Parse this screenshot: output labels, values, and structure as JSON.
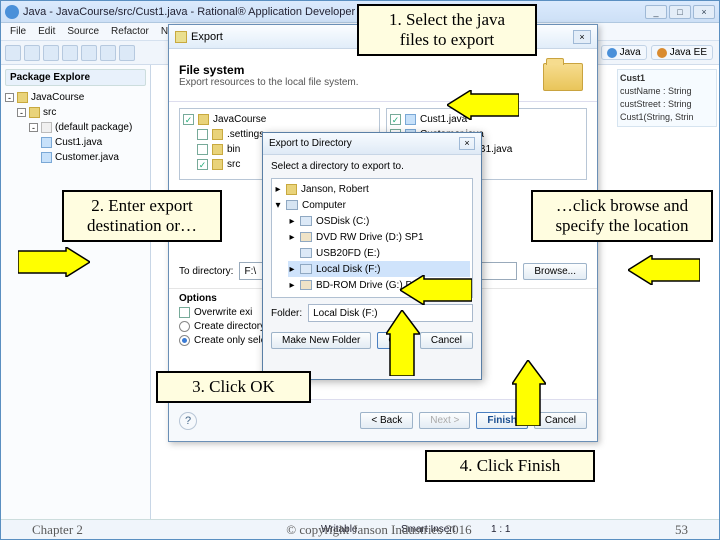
{
  "window": {
    "title": "Java - JavaCourse/src/Cust1.java - Rational® Application Developer for WebSphere® S…"
  },
  "win_btns": {
    "min": "_",
    "max": "□",
    "close": "×"
  },
  "menubar": [
    "File",
    "Edit",
    "Source",
    "Refactor",
    "Navig"
  ],
  "perspectives": {
    "java": "Java",
    "jee": "Java EE"
  },
  "sidebar": {
    "header": "Package Explore",
    "project": "JavaCourse",
    "src": "src",
    "pkg": "(default package)",
    "files": [
      "Cust1.java",
      "Customer.java"
    ]
  },
  "right_box": {
    "class": "Cust1",
    "f1": "custName : String",
    "f2": "custStreet : String",
    "m1": "Cust1(String, Strin"
  },
  "export": {
    "dlg_title": "Export",
    "heading": "File system",
    "sub": "Export resources to the local file system.",
    "close_x": "×",
    "left_tree": {
      "root": "JavaCourse",
      "nodes": [
        ".settings",
        "bin",
        "src"
      ]
    },
    "right_list": {
      "files": [
        "Cust1.java",
        "Customer.java",
        "Customerc2sB1.java"
      ],
      "checked": [
        true,
        false,
        false
      ]
    },
    "to_dir_label": "To directory:",
    "to_dir_value": "F:\\",
    "browse_btn": "Browse...",
    "options_label": "Options",
    "opt1": "Overwrite exi",
    "opt2": "Create directory",
    "opt3": "Create only sele",
    "back": "< Back",
    "next": "Next >",
    "finish": "Finish",
    "cancel": "Cancel",
    "q": "?"
  },
  "browse": {
    "title": "Export to Directory",
    "msg": "Select a directory to export to.",
    "close_x": "×",
    "items": [
      {
        "label": "Janson, Robert",
        "icon": "folder"
      },
      {
        "label": "Computer",
        "icon": "pc"
      },
      {
        "label": "OSDisk (C:)",
        "icon": "hdd"
      },
      {
        "label": "DVD RW Drive (D:) SP1",
        "icon": "dvd"
      },
      {
        "label": "USB20FD (E:)",
        "icon": "hdd"
      },
      {
        "label": "Local Disk (F:)",
        "icon": "hdd",
        "selected": true
      },
      {
        "label": "BD-ROM Drive (G:) D_ROM",
        "icon": "dvd"
      }
    ],
    "folder_label": "Folder:",
    "folder_value": "Local Disk (F:)",
    "new_folder": "Make New Folder",
    "ok": "OK",
    "cancel": "Cancel"
  },
  "status": {
    "chapter": "Chapter 2",
    "writable": "Writable",
    "smart": "Smart Insert",
    "pos": "1 : 1"
  },
  "annotations": {
    "a1": "1. Select the java",
    "a1b": "files to export",
    "a2": "2. Enter export",
    "a2b": "destination or…",
    "a3": "…click browse and",
    "a3b": "specify the location",
    "a4": "3. Click OK",
    "a5": "4. Click Finish"
  },
  "slide": {
    "copyright": "© copyright Janson Industries 2016",
    "page": "53"
  }
}
